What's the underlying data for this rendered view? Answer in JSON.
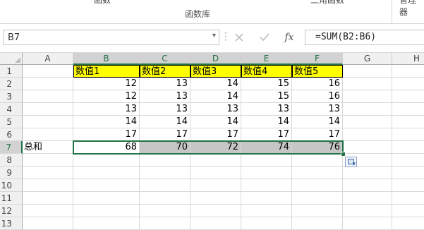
{
  "ribbon": {
    "clipped_left": "函数",
    "clipped_mid": "三角函数",
    "clipped_right": "管理器",
    "group_label": "函数库"
  },
  "formula_bar": {
    "name_box": "B7",
    "cancel_icon": "close-icon",
    "enter_icon": "check-icon",
    "fx_label": "fx",
    "formula": "=SUM(B2:B6)"
  },
  "columns": [
    "A",
    "B",
    "C",
    "D",
    "E",
    "F",
    "G",
    "H"
  ],
  "rows": [
    "1",
    "2",
    "3",
    "4",
    "5",
    "6",
    "7",
    "8",
    "9",
    "10",
    "11",
    "12",
    "13"
  ],
  "headers": [
    "数值1",
    "数值2",
    "数值3",
    "数值4",
    "数值5"
  ],
  "data_rows": [
    [
      "12",
      "13",
      "14",
      "15",
      "16"
    ],
    [
      "12",
      "13",
      "14",
      "15",
      "16"
    ],
    [
      "13",
      "13",
      "13",
      "13",
      "13"
    ],
    [
      "14",
      "14",
      "14",
      "14",
      "14"
    ],
    [
      "17",
      "17",
      "17",
      "17",
      "17"
    ]
  ],
  "total_label": "总和",
  "totals": [
    "68",
    "70",
    "72",
    "74",
    "76"
  ],
  "colors": {
    "selection_accent": "#217346",
    "header_fill": "#ffff00",
    "selected_fill": "#c6c6c6"
  }
}
